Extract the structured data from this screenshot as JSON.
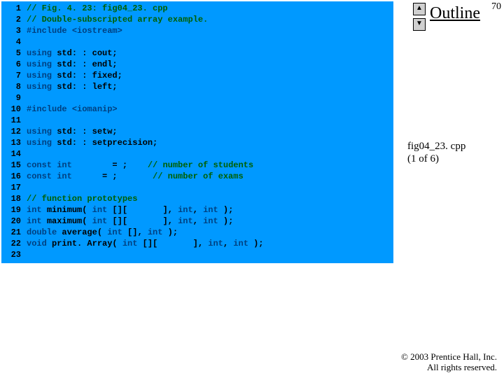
{
  "page_number": "70",
  "outline": {
    "label": "Outline",
    "up": "▲",
    "down": "▼"
  },
  "fig": {
    "name": "fig04_23. cpp",
    "part": "(1 of 6)"
  },
  "copyright": {
    "line1": "© 2003 Prentice Hall, Inc.",
    "line2": "All rights reserved."
  },
  "code": {
    "l1_comment": "// Fig. 4. 23: fig04_23. cpp",
    "l2_comment": "// Double-subscripted array example.",
    "l3_pp": "#include ",
    "l3_hdr": "<iostream>",
    "l5a": "using ",
    "l5b": "std: : cout;",
    "l6a": "using ",
    "l6b": "std: : endl;",
    "l7a": "using ",
    "l7b": "std: : fixed;",
    "l8a": "using ",
    "l8b": "std: : left;",
    "l10_pp": "#include ",
    "l10_hdr": "<iomanip>",
    "l12a": "using ",
    "l12b": "std: : setw;",
    "l13a": "using ",
    "l13b": "std: : setprecision;",
    "l15a": "const int",
    "l15b": "        = ;    ",
    "l15c": "// number of students",
    "l16a": "const int",
    "l16b": "      = ;       ",
    "l16c": "// number of exams",
    "l18_comment": "// function prototypes",
    "l19a": "int ",
    "l19b": "minimum( ",
    "l19c": "int ",
    "l19d": "[][       ], ",
    "l19e": "int",
    "l19f": ", ",
    "l19g": "int ",
    "l19h": ");",
    "l20a": "int ",
    "l20b": "maximum( ",
    "l20c": "int ",
    "l20d": "[][       ], ",
    "l20e": "int",
    "l20f": ", ",
    "l20g": "int ",
    "l20h": ");",
    "l21a": "double ",
    "l21b": "average( ",
    "l21c": "int ",
    "l21d": "[], ",
    "l21e": "int ",
    "l21f": ");",
    "l22a": "void ",
    "l22b": "print. Array( ",
    "l22c": "int ",
    "l22d": "[][       ], ",
    "l22e": "int",
    "l22f": ", ",
    "l22g": "int ",
    "l22h": ");"
  },
  "ln": {
    "n1": "1",
    "n2": "2",
    "n3": "3",
    "n4": "4",
    "n5": "5",
    "n6": "6",
    "n7": "7",
    "n8": "8",
    "n9": "9",
    "n10": "10",
    "n11": "11",
    "n12": "12",
    "n13": "13",
    "n14": "14",
    "n15": "15",
    "n16": "16",
    "n17": "17",
    "n18": "18",
    "n19": "19",
    "n20": "20",
    "n21": "21",
    "n22": "22",
    "n23": "23"
  }
}
